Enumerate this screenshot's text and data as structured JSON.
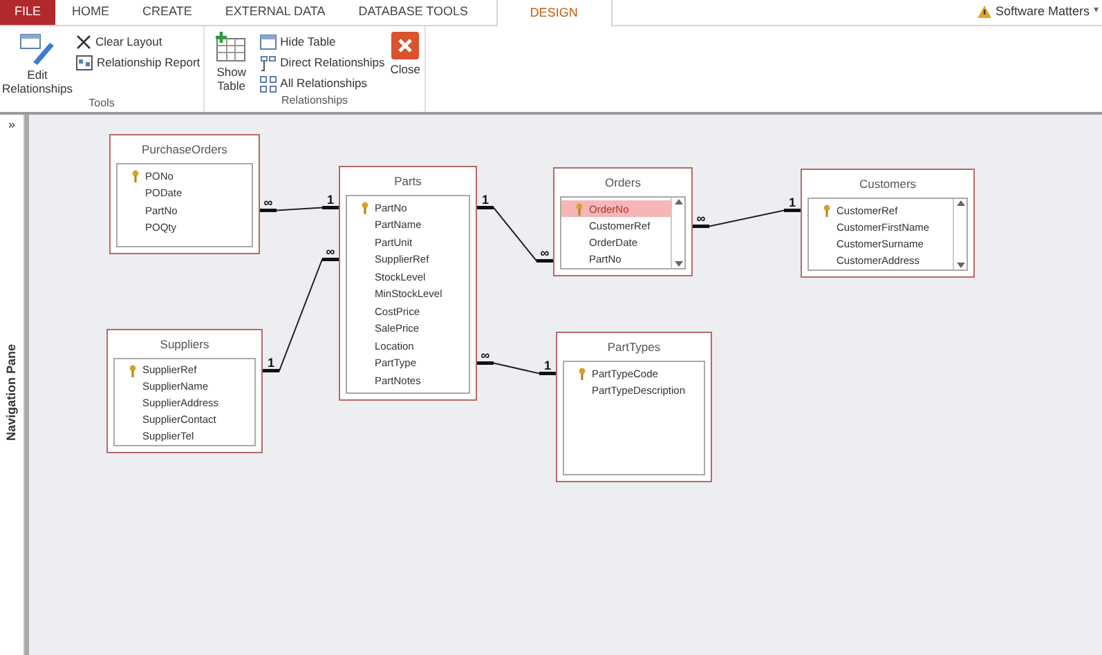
{
  "ribbon_tabs": [
    {
      "label": "FILE",
      "kind": "file",
      "selected": false
    },
    {
      "label": "HOME",
      "kind": "tab",
      "selected": false
    },
    {
      "label": "CREATE",
      "kind": "tab",
      "selected": false
    },
    {
      "label": "EXTERNAL DATA",
      "kind": "tab",
      "selected": false
    },
    {
      "label": "DATABASE TOOLS",
      "kind": "tab",
      "selected": false
    },
    {
      "label": "DESIGN",
      "kind": "tab",
      "selected": true
    }
  ],
  "account": {
    "name": "Software Matters",
    "caret": "▾"
  },
  "ribbon_groups": [
    {
      "label": "Tools",
      "buttons": [
        {
          "label": "Edit Relationships",
          "kind": "large"
        },
        {
          "label": "Clear Layout",
          "kind": "small"
        },
        {
          "label": "Relationship Report",
          "kind": "small"
        }
      ]
    },
    {
      "label": "Relationships",
      "buttons": [
        {
          "label": "Show Table",
          "kind": "large"
        },
        {
          "label": "Hide Table",
          "kind": "small"
        },
        {
          "label": "Direct Relationships",
          "kind": "small"
        },
        {
          "label": "All Relationships",
          "kind": "small"
        },
        {
          "label": "Close",
          "kind": "large"
        }
      ]
    }
  ],
  "navigation_pane": {
    "label": "Navigation Pane",
    "toggle": "»"
  },
  "tables": [
    {
      "title": "PurchaseOrders",
      "scrollable": false,
      "fields": [
        {
          "name": "PONo",
          "key": true,
          "selected": false
        },
        {
          "name": "PODate",
          "key": false,
          "selected": false
        },
        {
          "name": "PartNo",
          "key": false,
          "selected": false
        },
        {
          "name": "POQty",
          "key": false,
          "selected": false
        }
      ]
    },
    {
      "title": "Parts",
      "scrollable": false,
      "fields": [
        {
          "name": "PartNo",
          "key": true,
          "selected": false
        },
        {
          "name": "PartName",
          "key": false,
          "selected": false
        },
        {
          "name": "PartUnit",
          "key": false,
          "selected": false
        },
        {
          "name": "SupplierRef",
          "key": false,
          "selected": false
        },
        {
          "name": "StockLevel",
          "key": false,
          "selected": false
        },
        {
          "name": "MinStockLevel",
          "key": false,
          "selected": false
        },
        {
          "name": "CostPrice",
          "key": false,
          "selected": false
        },
        {
          "name": "SalePrice",
          "key": false,
          "selected": false
        },
        {
          "name": "Location",
          "key": false,
          "selected": false
        },
        {
          "name": "PartType",
          "key": false,
          "selected": false
        },
        {
          "name": "PartNotes",
          "key": false,
          "selected": false
        }
      ]
    },
    {
      "title": "Orders",
      "scrollable": true,
      "fields": [
        {
          "name": "OrderNo",
          "key": true,
          "selected": true
        },
        {
          "name": "CustomerRef",
          "key": false,
          "selected": false
        },
        {
          "name": "OrderDate",
          "key": false,
          "selected": false
        },
        {
          "name": "PartNo",
          "key": false,
          "selected": false
        }
      ]
    },
    {
      "title": "Customers",
      "scrollable": true,
      "fields": [
        {
          "name": "CustomerRef",
          "key": true,
          "selected": false
        },
        {
          "name": "CustomerFirstName",
          "key": false,
          "selected": false
        },
        {
          "name": "CustomerSurname",
          "key": false,
          "selected": false
        },
        {
          "name": "CustomerAddress",
          "key": false,
          "selected": false
        }
      ]
    },
    {
      "title": "Suppliers",
      "scrollable": false,
      "fields": [
        {
          "name": "SupplierRef",
          "key": true,
          "selected": false
        },
        {
          "name": "SupplierName",
          "key": false,
          "selected": false
        },
        {
          "name": "SupplierAddress",
          "key": false,
          "selected": false
        },
        {
          "name": "SupplierContact",
          "key": false,
          "selected": false
        },
        {
          "name": "SupplierTel",
          "key": false,
          "selected": false
        }
      ]
    },
    {
      "title": "PartTypes",
      "scrollable": false,
      "fields": [
        {
          "name": "PartTypeCode",
          "key": true,
          "selected": false
        },
        {
          "name": "PartTypeDescription",
          "key": false,
          "selected": false
        }
      ]
    }
  ],
  "relationships": [
    {
      "from_label": "∞",
      "to_label": "1"
    },
    {
      "from_label": "1",
      "to_label": "∞"
    },
    {
      "from_label": "1",
      "to_label": "∞"
    },
    {
      "from_label": "∞",
      "to_label": "1"
    },
    {
      "from_label": "∞",
      "to_label": "1"
    }
  ]
}
